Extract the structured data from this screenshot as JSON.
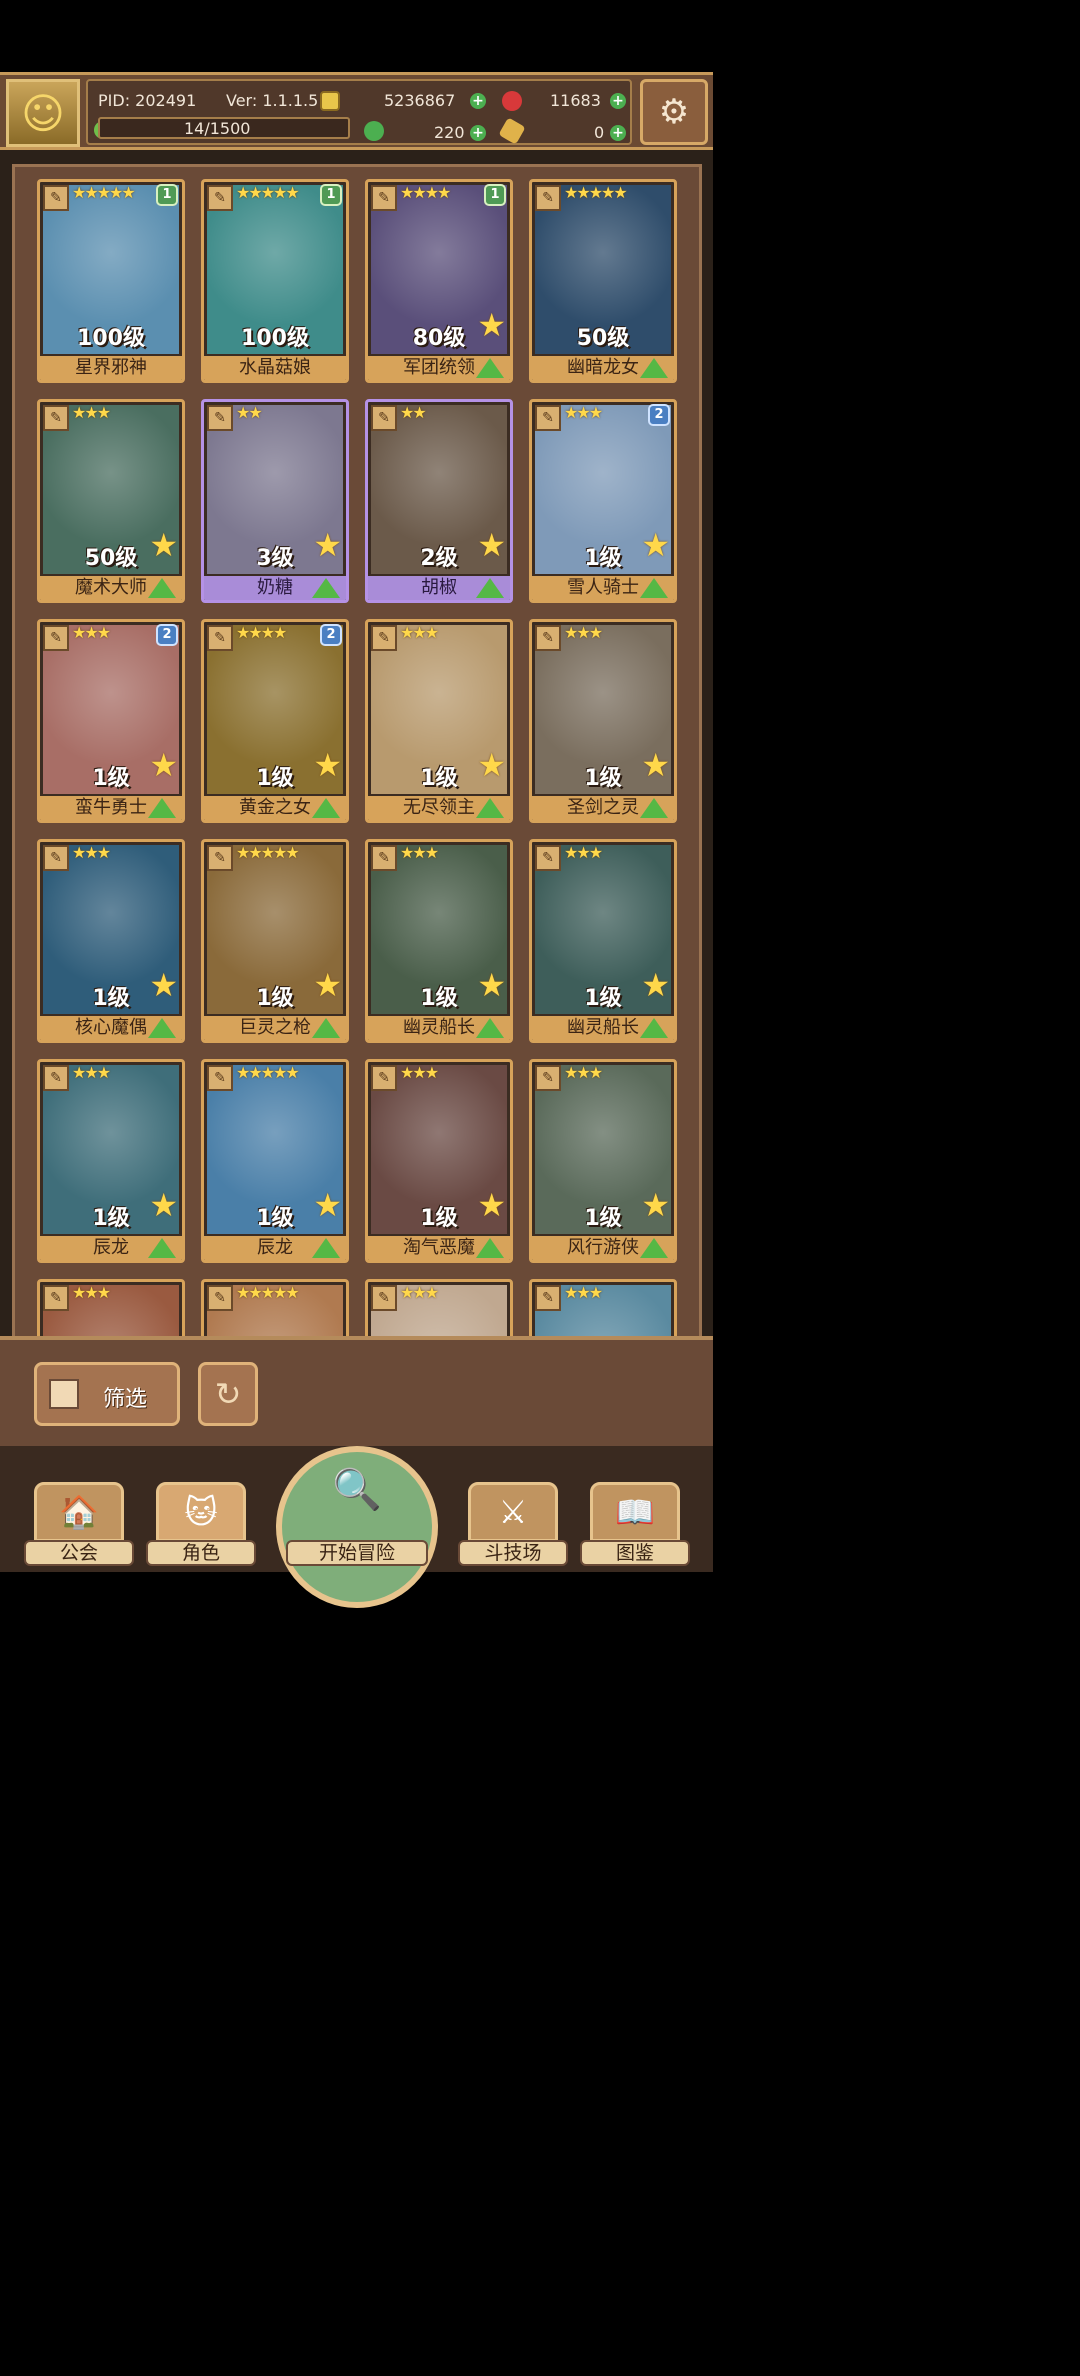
{
  "header": {
    "pid": "PID: 202491",
    "version": "Ver: 1.1.1.5",
    "gold": "5236867",
    "gems": "11683",
    "stamina": "14/1500",
    "clover": "220",
    "ticket": "0"
  },
  "cards": [
    {
      "stars": "★★★★★",
      "level": "100级",
      "name": "星界邪神",
      "badge": "1",
      "badge_color": "green",
      "style": "gold",
      "bg": "#5b8fb0",
      "bigstar": false,
      "up": false
    },
    {
      "stars": "★★★★★",
      "level": "100级",
      "name": "水晶菇娘",
      "badge": "1",
      "badge_color": "green",
      "style": "gold",
      "bg": "#3f8c8a",
      "bigstar": false,
      "up": false
    },
    {
      "stars": "★★★★",
      "level": "80级",
      "name": "军团统领",
      "badge": "1",
      "badge_color": "green",
      "style": "gold",
      "bg": "#5a4f7a",
      "bigstar": true,
      "up": true
    },
    {
      "stars": "★★★★★",
      "level": "50级",
      "name": "幽暗龙女",
      "badge": "",
      "badge_color": "",
      "style": "gold",
      "bg": "#2f4d6b",
      "bigstar": false,
      "up": true
    },
    {
      "stars": "★★★",
      "level": "50级",
      "name": "魔术大师",
      "badge": "",
      "badge_color": "",
      "style": "gold",
      "bg": "#4a6e60",
      "bigstar": true,
      "up": true
    },
    {
      "stars": "★★",
      "level": "3级",
      "name": "奶糖",
      "badge": "",
      "badge_color": "",
      "style": "purple",
      "bg": "#7d7890",
      "bigstar": true,
      "up": true
    },
    {
      "stars": "★★",
      "level": "2级",
      "name": "胡椒",
      "badge": "",
      "badge_color": "",
      "style": "purple",
      "bg": "#6b5a4a",
      "bigstar": true,
      "up": true
    },
    {
      "stars": "★★★",
      "level": "1级",
      "name": "雪人骑士",
      "badge": "2",
      "badge_color": "blue",
      "style": "gold",
      "bg": "#7f9ab8",
      "bigstar": true,
      "up": true
    },
    {
      "stars": "★★★",
      "level": "1级",
      "name": "蛮牛勇士",
      "badge": "2",
      "badge_color": "blue",
      "style": "gold",
      "bg": "#a86e66",
      "bigstar": true,
      "up": true
    },
    {
      "stars": "★★★★",
      "level": "1级",
      "name": "黄金之女",
      "badge": "2",
      "badge_color": "blue",
      "style": "gold",
      "bg": "#8a7030",
      "bigstar": true,
      "up": true
    },
    {
      "stars": "★★★",
      "level": "1级",
      "name": "无尽领主",
      "badge": "",
      "badge_color": "",
      "style": "gold",
      "bg": "#b89a6e",
      "bigstar": true,
      "up": true
    },
    {
      "stars": "★★★",
      "level": "1级",
      "name": "圣剑之灵",
      "badge": "",
      "badge_color": "",
      "style": "gold",
      "bg": "#7a6e5e",
      "bigstar": true,
      "up": true
    },
    {
      "stars": "★★★",
      "level": "1级",
      "name": "核心魔偶",
      "badge": "",
      "badge_color": "",
      "style": "gold",
      "bg": "#2f5d7a",
      "bigstar": true,
      "up": true
    },
    {
      "stars": "★★★★★",
      "level": "1级",
      "name": "巨灵之枪",
      "badge": "",
      "badge_color": "",
      "style": "gold",
      "bg": "#8a6a3a",
      "bigstar": true,
      "up": true
    },
    {
      "stars": "★★★",
      "level": "1级",
      "name": "幽灵船长",
      "badge": "",
      "badge_color": "",
      "style": "gold",
      "bg": "#4a5e4a",
      "bigstar": true,
      "up": true
    },
    {
      "stars": "★★★",
      "level": "1级",
      "name": "幽灵船长",
      "badge": "",
      "badge_color": "",
      "style": "gold",
      "bg": "#3e5e5a",
      "bigstar": true,
      "up": true
    },
    {
      "stars": "★★★",
      "level": "1级",
      "name": "辰龙",
      "badge": "",
      "badge_color": "",
      "style": "gold",
      "bg": "#3f6e7a",
      "bigstar": true,
      "up": true
    },
    {
      "stars": "★★★★★",
      "level": "1级",
      "name": "辰龙",
      "badge": "",
      "badge_color": "",
      "style": "gold",
      "bg": "#4a7fa8",
      "bigstar": true,
      "up": true
    },
    {
      "stars": "★★★",
      "level": "1级",
      "name": "淘气恶魔",
      "badge": "",
      "badge_color": "",
      "style": "gold",
      "bg": "#6a4a44",
      "bigstar": true,
      "up": true
    },
    {
      "stars": "★★★",
      "level": "1级",
      "name": "风行游侠",
      "badge": "",
      "badge_color": "",
      "style": "gold",
      "bg": "#5a6a5a",
      "bigstar": true,
      "up": true
    },
    {
      "stars": "★★★",
      "level": "",
      "name": "",
      "badge": "",
      "badge_color": "",
      "style": "gold",
      "bg": "#9a5a40",
      "bigstar": false,
      "up": false
    },
    {
      "stars": "★★★★★",
      "level": "",
      "name": "",
      "badge": "",
      "badge_color": "",
      "style": "gold",
      "bg": "#b07a50",
      "bigstar": false,
      "up": false
    },
    {
      "stars": "★★★",
      "level": "",
      "name": "",
      "badge": "",
      "badge_color": "",
      "style": "gold",
      "bg": "#c0a890",
      "bigstar": false,
      "up": false
    },
    {
      "stars": "★★★",
      "level": "",
      "name": "",
      "badge": "",
      "badge_color": "",
      "style": "gold",
      "bg": "#5a8aa0",
      "bigstar": false,
      "up": false
    }
  ],
  "controls": {
    "filter_label": "筛选",
    "refresh_icon": "refresh-icon"
  },
  "nav": {
    "guild": "公会",
    "characters": "角色",
    "adventure": "开始冒险",
    "arena": "斗技场",
    "codex": "图鉴"
  }
}
